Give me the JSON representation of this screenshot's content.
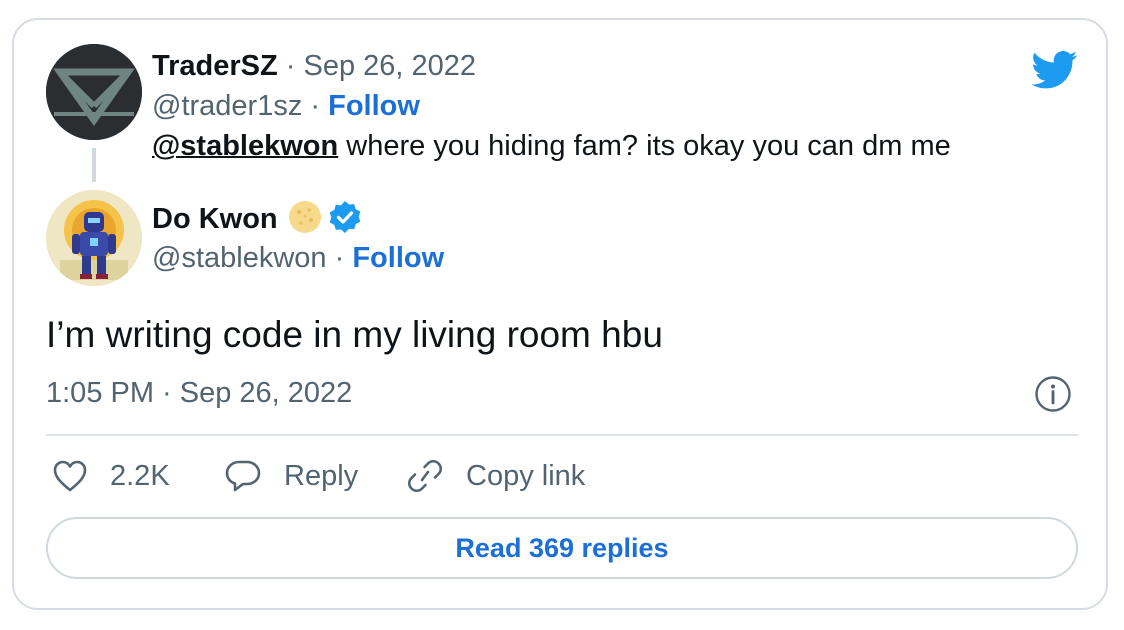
{
  "quoted_tweet": {
    "display_name": "TraderSZ",
    "separator": "·",
    "date": "Sep 26, 2022",
    "handle": "@trader1sz",
    "follow_label": "Follow",
    "mention": "@stablekwon",
    "text": "where you hiding fam? its okay you can dm me"
  },
  "reply_tweet": {
    "display_name": "Do Kwon",
    "handle": "@stablekwon",
    "separator": "·",
    "follow_label": "Follow",
    "text": "I’m writing code in my living room hbu",
    "timestamp": "1:05 PM · Sep 26, 2022"
  },
  "actions": {
    "like_count": "2.2K",
    "reply_label": "Reply",
    "copy_link_label": "Copy link"
  },
  "read_replies_label": "Read 369 replies",
  "colors": {
    "brand": "#1d9bf0",
    "link": "#1d6fd8",
    "text_primary": "#0f1419",
    "text_secondary": "#536471",
    "border": "#d6dce1"
  },
  "icons": [
    "twitter-bird-icon",
    "verified-badge-icon",
    "coin-emoji-icon",
    "info-icon",
    "heart-icon",
    "speech-bubble-icon",
    "link-icon"
  ]
}
